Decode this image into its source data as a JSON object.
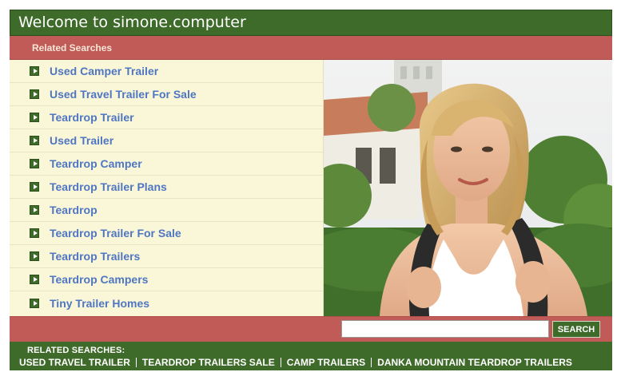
{
  "header": {
    "title": "Welcome to simone.computer"
  },
  "related_bar": {
    "label": "Related Searches"
  },
  "links": [
    {
      "label": "Used Camper Trailer"
    },
    {
      "label": "Used Travel Trailer For Sale"
    },
    {
      "label": "Teardrop Trailer"
    },
    {
      "label": "Used Trailer"
    },
    {
      "label": "Teardrop Camper"
    },
    {
      "label": "Teardrop Trailer Plans"
    },
    {
      "label": "Teardrop"
    },
    {
      "label": "Teardrop Trailer For Sale"
    },
    {
      "label": "Teardrop Trailers"
    },
    {
      "label": "Teardrop Campers"
    },
    {
      "label": "Tiny Trailer Homes"
    }
  ],
  "search": {
    "value": "",
    "button_label": "SEARCH"
  },
  "footer": {
    "title": "RELATED SEARCHES:",
    "links": [
      {
        "label": "USED TRAVEL TRAILER"
      },
      {
        "label": "TEARDROP TRAILERS SALE"
      },
      {
        "label": "CAMP TRAILERS"
      },
      {
        "label": "DANKA MOUNTAIN TEARDROP TRAILERS"
      }
    ]
  },
  "colors": {
    "header_green": "#3f6b2a",
    "bar_red": "#c05b57",
    "link_blue": "#4f76c2",
    "panel_cream": "#faf7d9"
  },
  "icons": {
    "bullet": "arrow-bullet-icon"
  }
}
